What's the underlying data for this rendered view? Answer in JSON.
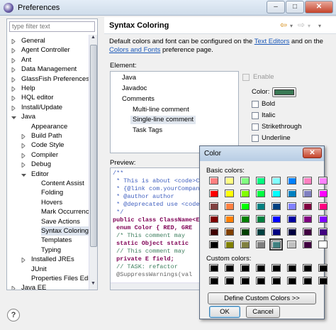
{
  "window": {
    "title": "Preferences",
    "min": "–",
    "max": "□",
    "close": "✕"
  },
  "left": {
    "filter_placeholder": "type filter text",
    "tree": [
      "General",
      "Agent Controller",
      "Ant",
      "Data Management",
      "GlassFish Preferences",
      "Help",
      "HQL editor",
      "Install/Update",
      "Java",
      "Appearance",
      "Build Path",
      "Code Style",
      "Compiler",
      "Debug",
      "Editor",
      "Content Assist",
      "Folding",
      "Hovers",
      "Mark Occurrences",
      "Save Actions",
      "Syntax Coloring",
      "Templates",
      "Typing",
      "Installed JREs",
      "JUnit",
      "Properties Files Edito",
      "Java EE"
    ]
  },
  "page": {
    "title": "Syntax Coloring",
    "back": "⇦",
    "forward": "⇨",
    "menu": "▾",
    "desc1": "Default colors and font can be configured on the ",
    "link1": "Text Editors",
    "desc2": " and on the",
    "link2": "Colors and Fonts",
    "desc3": " preference page.",
    "element_label": "Element:",
    "elements": [
      "Java",
      "Javadoc",
      "Comments",
      "Multi-line comment",
      "Single-line comment",
      "Task Tags"
    ],
    "enable": "Enable",
    "color_label": "Color:",
    "bold": "Bold",
    "italic": "Italic",
    "strike": "Strikethrough",
    "underline": "Underline",
    "preview_label": "Preview:",
    "code": [
      "/**",
      " * This is about <code>Cl",
      " * {@link com.yourCompan",
      " * @author author",
      " * @deprecated use <code>",
      " */",
      "public class ClassName<E",
      " enum Color { RED, GRE",
      " /* This comment may",
      " static Object static",
      " // This comment may",
      " private E field;",
      " // TASK: refactor",
      " @SuppressWarnings(val"
    ]
  },
  "dialog": {
    "title": "Color",
    "close": "✕",
    "basic_label": "Basic colors:",
    "custom_label": "Custom colors:",
    "define": "Define Custom Colors >>",
    "ok": "OK",
    "cancel": "Cancel",
    "basic_colors": [
      "#ff8080",
      "#ffff80",
      "#80ff80",
      "#00ff80",
      "#80ffff",
      "#0080ff",
      "#ff80c0",
      "#ff80ff",
      "#ff0000",
      "#ffff00",
      "#80ff00",
      "#00ff40",
      "#00ffff",
      "#0080c0",
      "#8080c0",
      "#ff00ff",
      "#804040",
      "#ff8040",
      "#00ff00",
      "#008080",
      "#004080",
      "#8080ff",
      "#800040",
      "#ff0080",
      "#800000",
      "#ff8000",
      "#008000",
      "#008040",
      "#0000ff",
      "#0000a0",
      "#800080",
      "#8000ff",
      "#400000",
      "#804000",
      "#004000",
      "#004040",
      "#000080",
      "#000040",
      "#400040",
      "#400080",
      "#000000",
      "#808000",
      "#808040",
      "#808080",
      "#408080",
      "#c0c0c0",
      "#400040",
      "#ffffff"
    ],
    "custom_colors": [
      "#000000",
      "#000000",
      "#000000",
      "#000000",
      "#000000",
      "#000000",
      "#000000",
      "#000000",
      "#000000",
      "#000000",
      "#000000",
      "#000000",
      "#000000",
      "#000000",
      "#000000",
      "#000000"
    ]
  },
  "accent": {
    "selection": "#dde4ee",
    "swatch": "#3a7a55",
    "link": "#1b58b8"
  },
  "help": "?"
}
